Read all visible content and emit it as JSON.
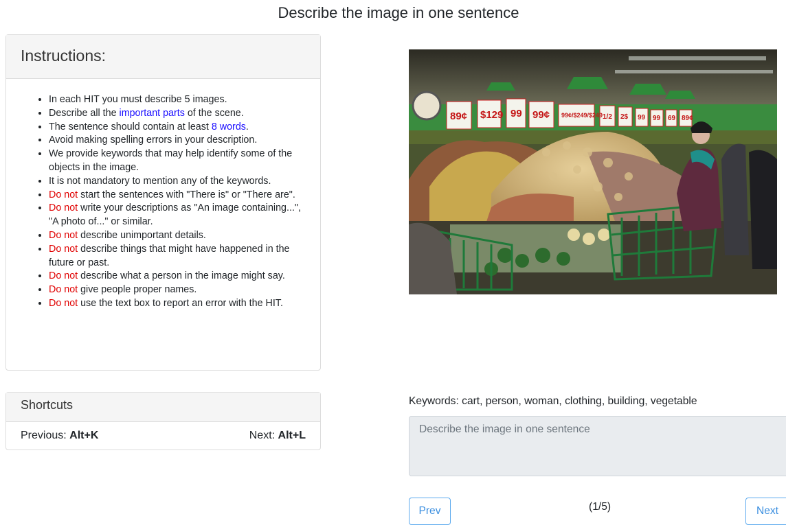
{
  "page": {
    "title": "Describe the image in one sentence"
  },
  "instructions": {
    "heading": "Instructions:",
    "items": [
      {
        "pre": "",
        "em": "",
        "post": "In each HIT you must describe 5 images."
      },
      {
        "pre": "Describe all the ",
        "em": "important parts",
        "post": " of the scene."
      },
      {
        "pre": "The sentence should contain at least ",
        "em": "8 words",
        "post": "."
      },
      {
        "pre": "",
        "em": "",
        "post": "Avoid making spelling errors in your description."
      },
      {
        "pre": "",
        "em": "",
        "post": "We provide keywords that may help identify some of the objects in the image."
      },
      {
        "pre": "",
        "em": "",
        "post": "It is not mandatory to mention any of the keywords."
      },
      {
        "pre": "",
        "em": "Do not",
        "post": " start the sentences with \"There is\" or \"There are\"."
      },
      {
        "pre": "",
        "em": "Do not",
        "post": " write your descriptions as \"An image containing...\", \"A photo of...\" or similar."
      },
      {
        "pre": "",
        "em": "Do not",
        "post": " describe unimportant details."
      },
      {
        "pre": "",
        "em": "Do not",
        "post": " describe things that might have happened in the future or past."
      },
      {
        "pre": "",
        "em": "Do not",
        "post": " describe what a person in the image might say."
      },
      {
        "pre": "",
        "em": "Do not",
        "post": " give people proper names."
      },
      {
        "pre": "",
        "em": "Do not",
        "post": " use the text box to report an error with the HIT."
      }
    ]
  },
  "shortcuts": {
    "heading": "Shortcuts",
    "prev_label": "Previous: ",
    "prev_key": "Alt+K",
    "next_label": "Next: ",
    "next_key": "Alt+L"
  },
  "image": {
    "signs": [
      "89¢",
      "$129",
      "99",
      "99¢",
      "99¢/$249/$249",
      "1/2",
      "2$",
      "99",
      "99",
      "69",
      "89¢"
    ]
  },
  "task": {
    "keywords_label": "Keywords: ",
    "keywords": "cart, person, woman, clothing, building, vegetable",
    "placeholder": "Describe the image in one sentence",
    "value": ""
  },
  "nav": {
    "prev": "Prev",
    "counter": "(1/5)",
    "next": "Next"
  },
  "colors": {
    "link_blue": "#1a0dff",
    "warning_red": "#e00000",
    "button_blue": "#3b8fe0"
  }
}
